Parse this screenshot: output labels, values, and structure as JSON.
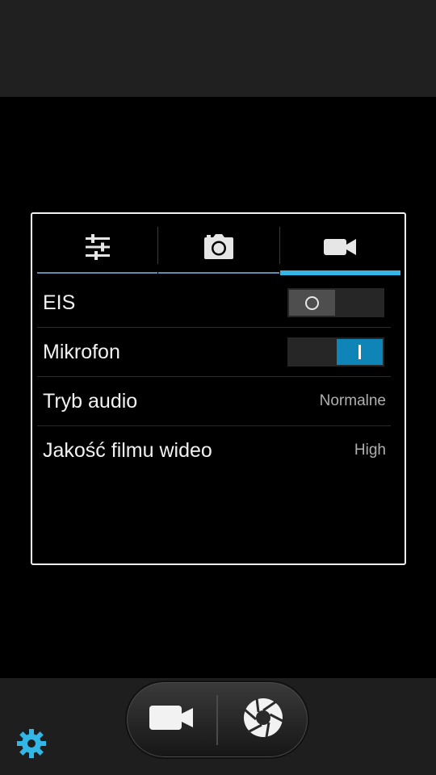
{
  "tabs": [
    {
      "icon": "sliders-icon",
      "active": false
    },
    {
      "icon": "camera-icon",
      "active": false
    },
    {
      "icon": "video-camera-icon",
      "active": true
    }
  ],
  "settings": [
    {
      "label": "EIS",
      "type": "switch",
      "state": "off"
    },
    {
      "label": "Mikrofon",
      "type": "switch",
      "state": "on"
    },
    {
      "label": "Tryb audio",
      "type": "value",
      "value": "Normalne"
    },
    {
      "label": "Jakość filmu wideo",
      "type": "value",
      "value": "High"
    }
  ],
  "controls": {
    "left": "video-camera-icon",
    "right": "shutter-icon",
    "settings": "gear-icon"
  },
  "colors": {
    "accent": "#33b5e5",
    "switch_on": "#0f84b6",
    "gear": "#33b5e5"
  }
}
